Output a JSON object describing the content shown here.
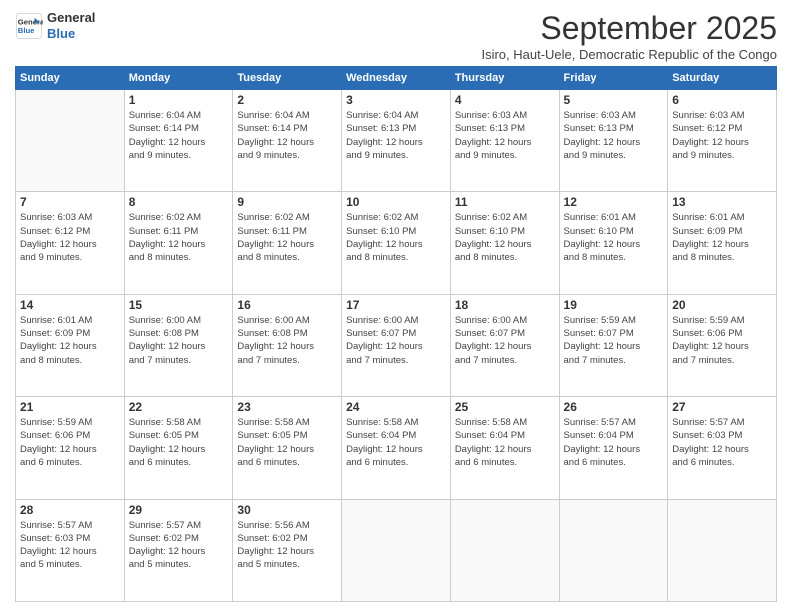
{
  "logo": {
    "line1": "General",
    "line2": "Blue"
  },
  "title": "September 2025",
  "subtitle": "Isiro, Haut-Uele, Democratic Republic of the Congo",
  "days_of_week": [
    "Sunday",
    "Monday",
    "Tuesday",
    "Wednesday",
    "Thursday",
    "Friday",
    "Saturday"
  ],
  "weeks": [
    [
      {
        "day": "",
        "info": ""
      },
      {
        "day": "1",
        "info": "Sunrise: 6:04 AM\nSunset: 6:14 PM\nDaylight: 12 hours\nand 9 minutes."
      },
      {
        "day": "2",
        "info": "Sunrise: 6:04 AM\nSunset: 6:14 PM\nDaylight: 12 hours\nand 9 minutes."
      },
      {
        "day": "3",
        "info": "Sunrise: 6:04 AM\nSunset: 6:13 PM\nDaylight: 12 hours\nand 9 minutes."
      },
      {
        "day": "4",
        "info": "Sunrise: 6:03 AM\nSunset: 6:13 PM\nDaylight: 12 hours\nand 9 minutes."
      },
      {
        "day": "5",
        "info": "Sunrise: 6:03 AM\nSunset: 6:13 PM\nDaylight: 12 hours\nand 9 minutes."
      },
      {
        "day": "6",
        "info": "Sunrise: 6:03 AM\nSunset: 6:12 PM\nDaylight: 12 hours\nand 9 minutes."
      }
    ],
    [
      {
        "day": "7",
        "info": "Sunrise: 6:03 AM\nSunset: 6:12 PM\nDaylight: 12 hours\nand 9 minutes."
      },
      {
        "day": "8",
        "info": "Sunrise: 6:02 AM\nSunset: 6:11 PM\nDaylight: 12 hours\nand 8 minutes."
      },
      {
        "day": "9",
        "info": "Sunrise: 6:02 AM\nSunset: 6:11 PM\nDaylight: 12 hours\nand 8 minutes."
      },
      {
        "day": "10",
        "info": "Sunrise: 6:02 AM\nSunset: 6:10 PM\nDaylight: 12 hours\nand 8 minutes."
      },
      {
        "day": "11",
        "info": "Sunrise: 6:02 AM\nSunset: 6:10 PM\nDaylight: 12 hours\nand 8 minutes."
      },
      {
        "day": "12",
        "info": "Sunrise: 6:01 AM\nSunset: 6:10 PM\nDaylight: 12 hours\nand 8 minutes."
      },
      {
        "day": "13",
        "info": "Sunrise: 6:01 AM\nSunset: 6:09 PM\nDaylight: 12 hours\nand 8 minutes."
      }
    ],
    [
      {
        "day": "14",
        "info": "Sunrise: 6:01 AM\nSunset: 6:09 PM\nDaylight: 12 hours\nand 8 minutes."
      },
      {
        "day": "15",
        "info": "Sunrise: 6:00 AM\nSunset: 6:08 PM\nDaylight: 12 hours\nand 7 minutes."
      },
      {
        "day": "16",
        "info": "Sunrise: 6:00 AM\nSunset: 6:08 PM\nDaylight: 12 hours\nand 7 minutes."
      },
      {
        "day": "17",
        "info": "Sunrise: 6:00 AM\nSunset: 6:07 PM\nDaylight: 12 hours\nand 7 minutes."
      },
      {
        "day": "18",
        "info": "Sunrise: 6:00 AM\nSunset: 6:07 PM\nDaylight: 12 hours\nand 7 minutes."
      },
      {
        "day": "19",
        "info": "Sunrise: 5:59 AM\nSunset: 6:07 PM\nDaylight: 12 hours\nand 7 minutes."
      },
      {
        "day": "20",
        "info": "Sunrise: 5:59 AM\nSunset: 6:06 PM\nDaylight: 12 hours\nand 7 minutes."
      }
    ],
    [
      {
        "day": "21",
        "info": "Sunrise: 5:59 AM\nSunset: 6:06 PM\nDaylight: 12 hours\nand 6 minutes."
      },
      {
        "day": "22",
        "info": "Sunrise: 5:58 AM\nSunset: 6:05 PM\nDaylight: 12 hours\nand 6 minutes."
      },
      {
        "day": "23",
        "info": "Sunrise: 5:58 AM\nSunset: 6:05 PM\nDaylight: 12 hours\nand 6 minutes."
      },
      {
        "day": "24",
        "info": "Sunrise: 5:58 AM\nSunset: 6:04 PM\nDaylight: 12 hours\nand 6 minutes."
      },
      {
        "day": "25",
        "info": "Sunrise: 5:58 AM\nSunset: 6:04 PM\nDaylight: 12 hours\nand 6 minutes."
      },
      {
        "day": "26",
        "info": "Sunrise: 5:57 AM\nSunset: 6:04 PM\nDaylight: 12 hours\nand 6 minutes."
      },
      {
        "day": "27",
        "info": "Sunrise: 5:57 AM\nSunset: 6:03 PM\nDaylight: 12 hours\nand 6 minutes."
      }
    ],
    [
      {
        "day": "28",
        "info": "Sunrise: 5:57 AM\nSunset: 6:03 PM\nDaylight: 12 hours\nand 5 minutes."
      },
      {
        "day": "29",
        "info": "Sunrise: 5:57 AM\nSunset: 6:02 PM\nDaylight: 12 hours\nand 5 minutes."
      },
      {
        "day": "30",
        "info": "Sunrise: 5:56 AM\nSunset: 6:02 PM\nDaylight: 12 hours\nand 5 minutes."
      },
      {
        "day": "",
        "info": ""
      },
      {
        "day": "",
        "info": ""
      },
      {
        "day": "",
        "info": ""
      },
      {
        "day": "",
        "info": ""
      }
    ]
  ]
}
